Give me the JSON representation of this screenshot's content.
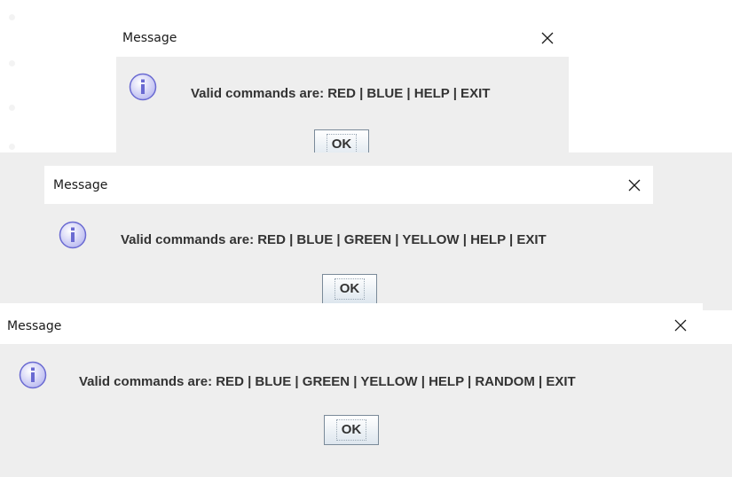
{
  "dialogs": [
    {
      "title": "Message",
      "message": "Valid commands are: RED | BLUE | HELP | EXIT",
      "ok_label": "OK",
      "icon": "info-icon",
      "close_icon": "close-icon"
    },
    {
      "title": "Message",
      "message": "Valid commands are: RED | BLUE | GREEN | YELLOW | HELP | EXIT",
      "ok_label": "OK",
      "icon": "info-icon",
      "close_icon": "close-icon"
    },
    {
      "title": "Message",
      "message": "Valid commands are: RED | BLUE | GREEN | YELLOW | HELP | RANDOM | EXIT",
      "ok_label": "OK",
      "icon": "info-icon",
      "close_icon": "close-icon"
    }
  ],
  "colors": {
    "dialog_body": "#eeeeee",
    "titlebar": "#ffffff",
    "info_icon_fill": "#c9c9f5",
    "info_icon_stroke": "#6a6ad2"
  }
}
